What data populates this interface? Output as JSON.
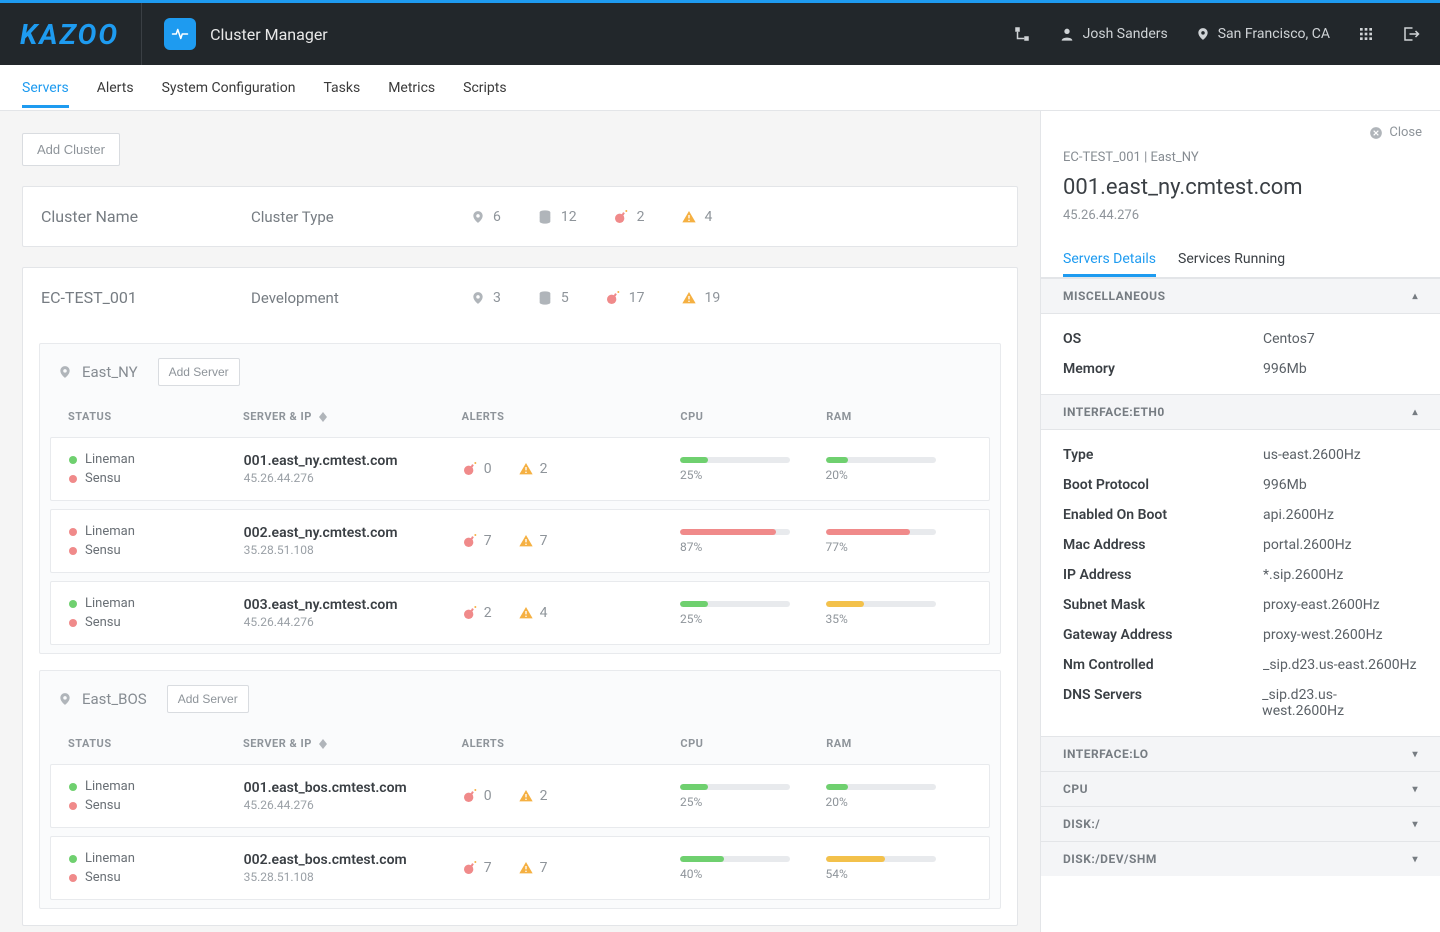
{
  "brand": "KAZOO",
  "app_title": "Cluster Manager",
  "user": {
    "name": "Josh Sanders",
    "location": "San Francisco, CA"
  },
  "nav": {
    "items": [
      "Servers",
      "Alerts",
      "System Configuration",
      "Tasks",
      "Metrics",
      "Scripts"
    ],
    "active": 0
  },
  "buttons": {
    "add_cluster": "Add Cluster",
    "add_server": "Add Server"
  },
  "columns": {
    "status": "STATUS",
    "server": "SERVER & IP",
    "alerts": "ALERTS",
    "cpu": "CPU",
    "ram": "RAM"
  },
  "clusters": [
    {
      "name": "Cluster Name",
      "type": "Cluster Type",
      "stats": {
        "locations": "6",
        "db": "12",
        "critical": "2",
        "warning": "4"
      },
      "regions": []
    },
    {
      "name": "EC-TEST_001",
      "type": "Development",
      "stats": {
        "locations": "3",
        "db": "5",
        "critical": "17",
        "warning": "19"
      },
      "regions": [
        {
          "name": "East_NY",
          "servers": [
            {
              "lineman": "green",
              "sensu": "red",
              "host": "001.east_ny.cmtest.com",
              "ip": "45.26.44.276",
              "critical": "0",
              "warning": "2",
              "cpu": 25,
              "cpu_color": "green",
              "ram": 20,
              "ram_color": "green"
            },
            {
              "lineman": "red",
              "sensu": "red",
              "host": "002.east_ny.cmtest.com",
              "ip": "35.28.51.108",
              "critical": "7",
              "warning": "7",
              "cpu": 87,
              "cpu_color": "red",
              "ram": 77,
              "ram_color": "red"
            },
            {
              "lineman": "green",
              "sensu": "red",
              "host": "003.east_ny.cmtest.com",
              "ip": "45.26.44.276",
              "critical": "2",
              "warning": "4",
              "cpu": 25,
              "cpu_color": "green",
              "ram": 35,
              "ram_color": "yellow"
            }
          ]
        },
        {
          "name": "East_BOS",
          "servers": [
            {
              "lineman": "green",
              "sensu": "red",
              "host": "001.east_bos.cmtest.com",
              "ip": "45.26.44.276",
              "critical": "0",
              "warning": "2",
              "cpu": 25,
              "cpu_color": "green",
              "ram": 20,
              "ram_color": "green"
            },
            {
              "lineman": "green",
              "sensu": "red",
              "host": "002.east_bos.cmtest.com",
              "ip": "35.28.51.108",
              "critical": "7",
              "warning": "7",
              "cpu": 40,
              "cpu_color": "green",
              "ram": 54,
              "ram_color": "yellow"
            }
          ]
        }
      ]
    }
  ],
  "sidepanel": {
    "close": "Close",
    "breadcrumb": "EC-TEST_001  |  East_NY",
    "title": "001.east_ny.cmtest.com",
    "subtitle": "45.26.44.276",
    "tabs": [
      "Servers Details",
      "Services Running"
    ],
    "active_tab": 0,
    "sections": [
      {
        "title": "MISCELLANEOUS",
        "open": true,
        "rows": [
          {
            "k": "OS",
            "v": "Centos7"
          },
          {
            "k": "Memory",
            "v": "996Mb"
          }
        ]
      },
      {
        "title": "INTERFACE:ETH0",
        "open": true,
        "rows": [
          {
            "k": "Type",
            "v": "us-east.2600Hz"
          },
          {
            "k": "Boot Protocol",
            "v": "996Mb"
          },
          {
            "k": "Enabled On Boot",
            "v": "api.2600Hz"
          },
          {
            "k": "Mac Address",
            "v": "portal.2600Hz"
          },
          {
            "k": "IP Address",
            "v": "*.sip.2600Hz"
          },
          {
            "k": "Subnet Mask",
            "v": "proxy-east.2600Hz"
          },
          {
            "k": "Gateway Address",
            "v": "proxy-west.2600Hz"
          },
          {
            "k": "Nm Controlled",
            "v": "_sip.d23.us-east.2600Hz"
          },
          {
            "k": "DNS Servers",
            "v": "_sip.d23.us-west.2600Hz"
          }
        ]
      },
      {
        "title": "INTERFACE:LO",
        "open": false,
        "rows": []
      },
      {
        "title": "CPU",
        "open": false,
        "rows": []
      },
      {
        "title": "DISK:/",
        "open": false,
        "rows": []
      },
      {
        "title": "DISK:/DEV/SHM",
        "open": false,
        "rows": []
      }
    ]
  },
  "status_labels": {
    "lineman": "Lineman",
    "sensu": "Sensu"
  }
}
